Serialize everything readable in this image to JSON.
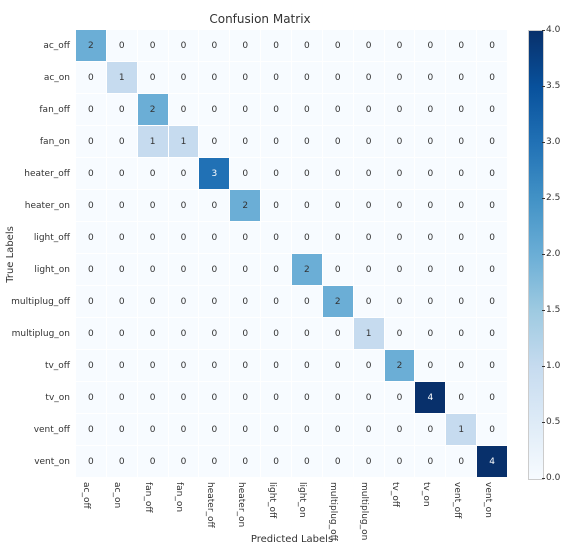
{
  "chart_data": {
    "type": "heatmap",
    "title": "Confusion Matrix",
    "xlabel": "Predicted Labels",
    "ylabel": "True Labels",
    "categories": [
      "ac_off",
      "ac_on",
      "fan_off",
      "fan_on",
      "heater_off",
      "heater_on",
      "light_off",
      "light_on",
      "multiplug_off",
      "multiplug_on",
      "tv_off",
      "tv_on",
      "vent_off",
      "vent_on"
    ],
    "matrix": [
      [
        2,
        0,
        0,
        0,
        0,
        0,
        0,
        0,
        0,
        0,
        0,
        0,
        0,
        0
      ],
      [
        0,
        1,
        0,
        0,
        0,
        0,
        0,
        0,
        0,
        0,
        0,
        0,
        0,
        0
      ],
      [
        0,
        0,
        2,
        0,
        0,
        0,
        0,
        0,
        0,
        0,
        0,
        0,
        0,
        0
      ],
      [
        0,
        0,
        1,
        1,
        0,
        0,
        0,
        0,
        0,
        0,
        0,
        0,
        0,
        0
      ],
      [
        0,
        0,
        0,
        0,
        3,
        0,
        0,
        0,
        0,
        0,
        0,
        0,
        0,
        0
      ],
      [
        0,
        0,
        0,
        0,
        0,
        2,
        0,
        0,
        0,
        0,
        0,
        0,
        0,
        0
      ],
      [
        0,
        0,
        0,
        0,
        0,
        0,
        0,
        0,
        0,
        0,
        0,
        0,
        0,
        0
      ],
      [
        0,
        0,
        0,
        0,
        0,
        0,
        0,
        2,
        0,
        0,
        0,
        0,
        0,
        0
      ],
      [
        0,
        0,
        0,
        0,
        0,
        0,
        0,
        0,
        2,
        0,
        0,
        0,
        0,
        0
      ],
      [
        0,
        0,
        0,
        0,
        0,
        0,
        0,
        0,
        0,
        1,
        0,
        0,
        0,
        0
      ],
      [
        0,
        0,
        0,
        0,
        0,
        0,
        0,
        0,
        0,
        0,
        2,
        0,
        0,
        0
      ],
      [
        0,
        0,
        0,
        0,
        0,
        0,
        0,
        0,
        0,
        0,
        0,
        4,
        0,
        0
      ],
      [
        0,
        0,
        0,
        0,
        0,
        0,
        0,
        0,
        0,
        0,
        0,
        0,
        1,
        0
      ],
      [
        0,
        0,
        0,
        0,
        0,
        0,
        0,
        0,
        0,
        0,
        0,
        0,
        0,
        4
      ]
    ],
    "vmin": 0.0,
    "vmax": 4.0,
    "colorbar_ticks": [
      "0.0",
      "0.5",
      "1.0",
      "1.5",
      "2.0",
      "2.5",
      "3.0",
      "3.5",
      "4.0"
    ]
  }
}
